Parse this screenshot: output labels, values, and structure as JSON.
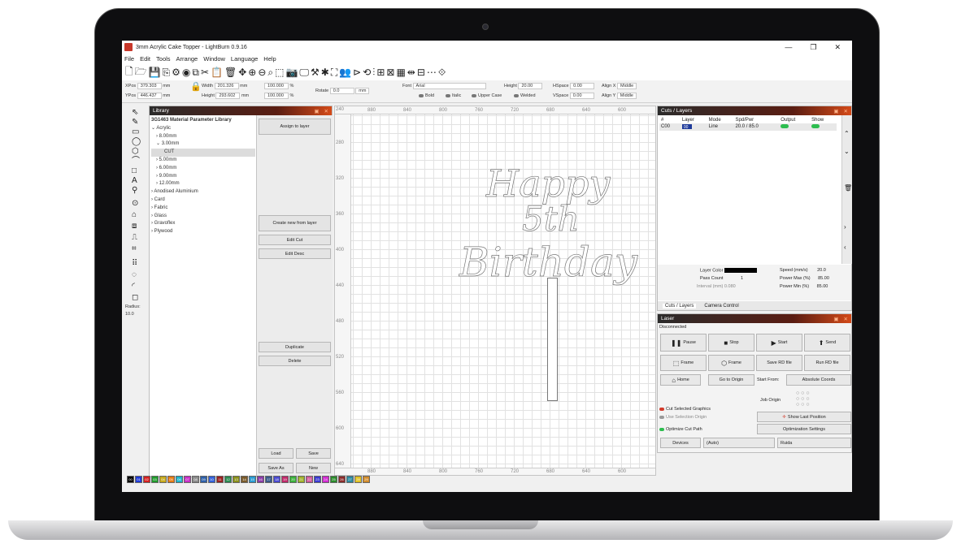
{
  "window": {
    "title": "3mm Acrylic Cake Topper - LightBurn 0.9.16",
    "minimize": "—",
    "maximize": "❐",
    "close": "✕"
  },
  "menu": [
    "File",
    "Edit",
    "Tools",
    "Arrange",
    "Window",
    "Language",
    "Help"
  ],
  "numeric": {
    "xpos_label": "XPos",
    "xpos_value": "379.303",
    "ypos_label": "YPos",
    "ypos_value": "446.437",
    "width_label": "Width",
    "width_value": "201.326",
    "height_label": "Height",
    "height_value": "293.602",
    "unit": "mm",
    "scale_w": "100.000",
    "scale_h": "100.000",
    "pct": "%",
    "rotate_label": "Rotate",
    "rotate_value": "0.0",
    "rotate_unit": "mm",
    "font_label": "Font",
    "font_value": "Arial",
    "font_height_label": "Height",
    "font_height_value": "20.00",
    "hspace_label": "HSpace",
    "hspace_value": "0.00",
    "vspace_label": "VSpace",
    "vspace_value": "0.00",
    "align_x_label": "Align X",
    "align_x_value": "Middle",
    "align_y_label": "Align Y",
    "align_y_value": "Middle",
    "bold": "Bold",
    "italic": "Italic",
    "upper": "Upper Case",
    "welded": "Welded"
  },
  "tools": {
    "radius_label": "Radius:",
    "radius_value": "10.0"
  },
  "library": {
    "header": "Library",
    "tree": [
      {
        "label": "3G1463 Material Parameter Library",
        "indent": 0
      },
      {
        "label": "⌄ Acrylic",
        "indent": 0
      },
      {
        "label": "› 8.00mm",
        "indent": 1
      },
      {
        "label": "⌄ 3.00mm",
        "indent": 1
      },
      {
        "label": "CUT",
        "indent": 2,
        "selected": true
      },
      {
        "label": "› 5.00mm",
        "indent": 1
      },
      {
        "label": "› 6.00mm",
        "indent": 1
      },
      {
        "label": "› 9.00mm",
        "indent": 1
      },
      {
        "label": "› 12.00mm",
        "indent": 1
      },
      {
        "label": "› Anodised Aluminium",
        "indent": 0
      },
      {
        "label": "› Card",
        "indent": 0
      },
      {
        "label": "› Fabric",
        "indent": 0
      },
      {
        "label": "› Glass",
        "indent": 0
      },
      {
        "label": "› Gravoflex",
        "indent": 0
      },
      {
        "label": "› Plywood",
        "indent": 0
      }
    ],
    "assign_btn": "Assign to layer",
    "create_btn": "Create new from layer",
    "edit_cut_btn": "Edit Cut",
    "edit_desc_btn": "Edit Desc",
    "duplicate_btn": "Duplicate",
    "delete_btn": "Delete",
    "load_btn": "Load",
    "save_btn": "Save",
    "save_as_btn": "Save As",
    "new_btn": "New"
  },
  "canvas": {
    "ruler_top": [
      "880",
      "840",
      "800",
      "760",
      "720",
      "680",
      "640",
      "600"
    ],
    "ruler_left": [
      "280",
      "320",
      "360",
      "400",
      "440",
      "480",
      "520",
      "560",
      "600",
      "640"
    ],
    "ruler_left_top": "240",
    "design_line1": "Happy",
    "design_line2": "5th",
    "design_line3": "Birthday"
  },
  "cuts": {
    "header": "Cuts / Layers",
    "columns": [
      "#",
      "Layer",
      "Mode",
      "Spd/Pwr",
      "Output",
      "Show"
    ],
    "rows": [
      {
        "num": "C00",
        "layer": "00",
        "mode": "Line",
        "spdpwr": "20.0 / 85.0"
      }
    ],
    "layer_color_label": "Layer Color",
    "speed_label": "Speed (mm/s)",
    "speed_value": "20.0",
    "pass_label": "Pass Count",
    "pass_value": "1",
    "power_max_label": "Power Max (%)",
    "power_max_value": "85.00",
    "interval_label": "Interval (mm)",
    "interval_value": "0.080",
    "power_min_label": "Power Min (%)",
    "power_min_value": "85.00",
    "tab_cuts": "Cuts / Layers",
    "tab_camera": "Camera Control"
  },
  "laser": {
    "header": "Laser",
    "status": "Disconnected",
    "pause": "Pause",
    "stop": "Stop",
    "start": "Start",
    "send": "Send",
    "frame1": "Frame",
    "frame2": "Frame",
    "save_rd": "Save RD file",
    "run_rd": "Run RD file",
    "home": "Home",
    "go_origin": "Go to Origin",
    "start_from_label": "Start From:",
    "start_from_value": "Absolute Coords",
    "job_origin_label": "Job Origin",
    "cut_selected": "Cut Selected Graphics",
    "use_selection": "Use Selection Origin",
    "optimize": "Optimize Cut Path",
    "show_last": "Show Last Position",
    "opt_settings": "Optimization Settings",
    "devices": "Devices",
    "device_value": "(Auto)",
    "ruida": "Ruida"
  },
  "palette": [
    {
      "label": "00",
      "color": "#000000"
    },
    {
      "label": "01",
      "color": "#1e3ad8"
    },
    {
      "label": "02",
      "color": "#d42020"
    },
    {
      "label": "03",
      "color": "#1f9a2c"
    },
    {
      "label": "04",
      "color": "#c5a81a"
    },
    {
      "label": "05",
      "color": "#e57a12"
    },
    {
      "label": "06",
      "color": "#1ab3c9"
    },
    {
      "label": "07",
      "color": "#c52ec5"
    },
    {
      "label": "08",
      "color": "#8a8a8a"
    },
    {
      "label": "09",
      "color": "#2d5fa8"
    },
    {
      "label": "10",
      "color": "#3260d9"
    },
    {
      "label": "11",
      "color": "#9a2020"
    },
    {
      "label": "12",
      "color": "#2b8a50"
    },
    {
      "label": "13",
      "color": "#8a8f1a"
    },
    {
      "label": "14",
      "color": "#7a5a2a"
    },
    {
      "label": "15",
      "color": "#2a9ad0"
    },
    {
      "label": "16",
      "color": "#8a3aa8"
    },
    {
      "label": "17",
      "color": "#3a5a8a"
    },
    {
      "label": "18",
      "color": "#4a4ad0"
    },
    {
      "label": "19",
      "color": "#c02a6a"
    },
    {
      "label": "20",
      "color": "#3ab03a"
    },
    {
      "label": "21",
      "color": "#a0b02a"
    },
    {
      "label": "22",
      "color": "#d05a9a"
    },
    {
      "label": "23",
      "color": "#3a3ad0"
    },
    {
      "label": "24",
      "color": "#d02ad0"
    },
    {
      "label": "25",
      "color": "#2a8a2a"
    },
    {
      "label": "26",
      "color": "#8a2a2a"
    },
    {
      "label": "27",
      "color": "#2a8aa0"
    },
    {
      "label": "28",
      "color": "#e0c020"
    },
    {
      "label": "29",
      "color": "#d08a2a"
    }
  ]
}
